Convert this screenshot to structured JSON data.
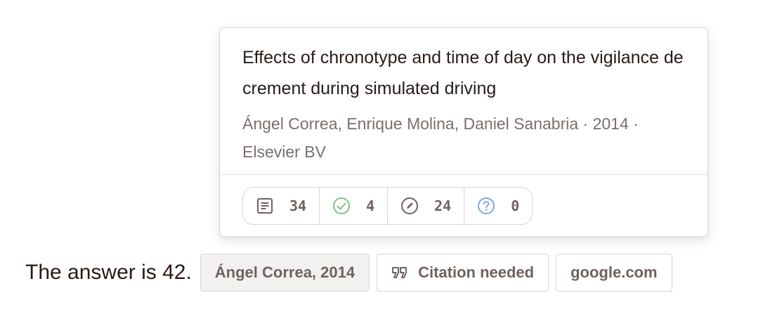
{
  "popover": {
    "title": "Effects of chronotype and time of day on the vigilance decrement during simulated driving",
    "authors_line": "Ángel Correa, Enrique Molina, Daniel Sanabria · 2014 · Elsevier BV",
    "stats": [
      {
        "icon": "document-lines-icon",
        "value": "34",
        "color": "#6e6360"
      },
      {
        "icon": "check-circle-icon",
        "value": "4",
        "color": "#7cc47f"
      },
      {
        "icon": "pencil-circle-icon",
        "value": "24",
        "color": "#6e6360"
      },
      {
        "icon": "question-circle-icon",
        "value": "0",
        "color": "#7ea6e8"
      }
    ]
  },
  "answer": {
    "text": "The answer is 42."
  },
  "chips": [
    {
      "label": "Ángel Correa, 2014"
    },
    {
      "label": "Citation needed",
      "icon": "quote-icon"
    },
    {
      "label": "google.com"
    }
  ],
  "colors": {
    "text_dark": "#2a1a17",
    "text_muted": "#7a6f6c",
    "border": "#d9d6d5",
    "check_green": "#7cc47f",
    "question_blue": "#7ea6e8"
  }
}
